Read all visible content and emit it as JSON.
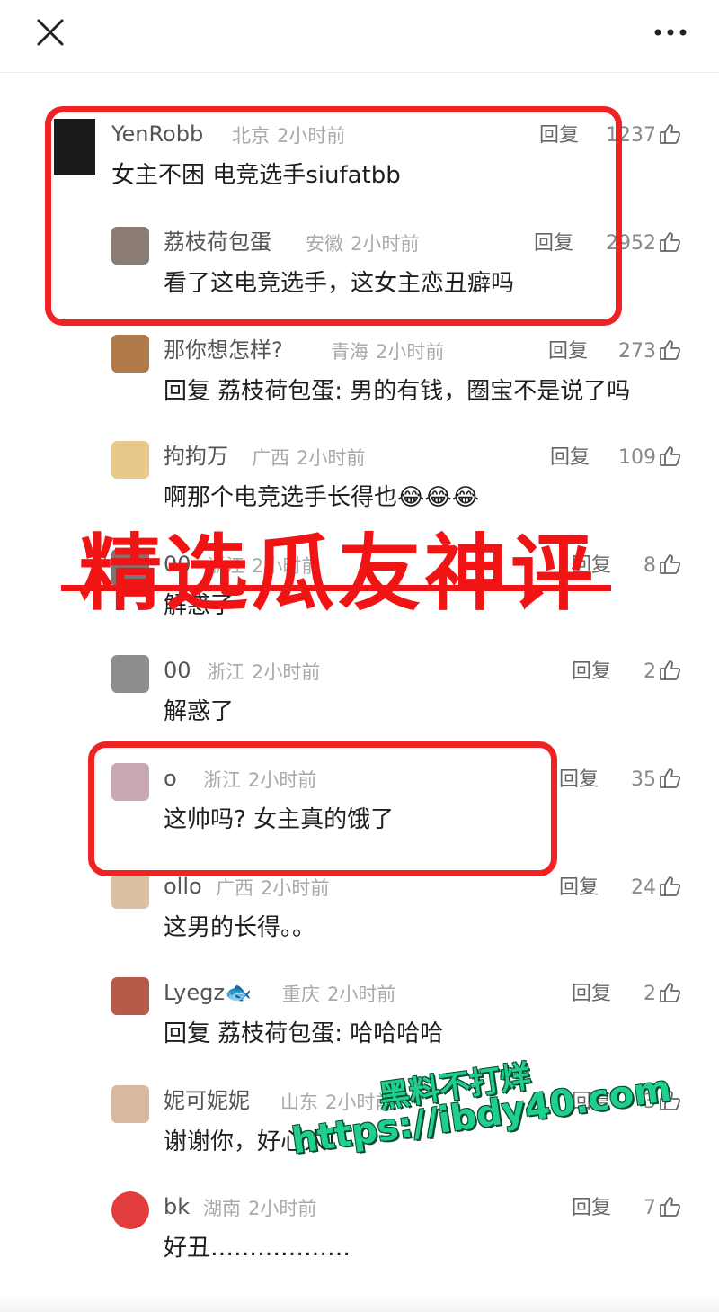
{
  "header": {
    "close_icon": "close-icon",
    "more_icon": "more-icon"
  },
  "comments": [
    {
      "name": "YenRobb",
      "location": "北京",
      "time": "2小时前",
      "reply": "回复",
      "likes": "1237",
      "text": "女主不困 电竞选手siufatbb",
      "avatar_color": "#1a1a1a"
    },
    {
      "name": "荔枝荷包蛋",
      "location": "安徽",
      "time": "2小时前",
      "reply": "回复",
      "likes": "2952",
      "text": "看了这电竞选手，这女主恋丑癖吗",
      "avatar_color": "#8a7b74"
    },
    {
      "name": "那你想怎样?",
      "location": "青海",
      "time": "2小时前",
      "reply": "回复",
      "likes": "273",
      "text": "回复 荔枝荷包蛋: 男的有钱，圈宝不是说了吗",
      "avatar_color": "#b07a4a"
    },
    {
      "name": "拘拘万",
      "location": "广西",
      "time": "2小时前",
      "reply": "回复",
      "likes": "109",
      "text": "啊那个电竞选手长得也😂😂😂",
      "avatar_color": "#e8c98a"
    },
    {
      "name": "00",
      "location": "浙江",
      "time": "2小时前",
      "reply": "回复",
      "likes": "8",
      "text": "解惑了",
      "avatar_color": "#777777"
    },
    {
      "name": "00",
      "location": "浙江",
      "time": "2小时前",
      "reply": "回复",
      "likes": "2",
      "text": "解惑了",
      "avatar_color": "#8d8d8d"
    },
    {
      "name": "o",
      "location": "浙江",
      "time": "2小时前",
      "reply": "回复",
      "likes": "35",
      "text": "这帅吗? 女主真的饿了",
      "avatar_color": "#c9a8b5"
    },
    {
      "name": "ollo",
      "location": "广西",
      "time": "2小时前",
      "reply": "回复",
      "likes": "24",
      "text": "这男的长得。。",
      "avatar_color": "#d9c0a0"
    },
    {
      "name": "Lyegz🐟",
      "location": "重庆",
      "time": "2小时前",
      "reply": "回复",
      "likes": "2",
      "text": "回复 荔枝荷包蛋: 哈哈哈哈",
      "avatar_color": "#b85a4a"
    },
    {
      "name": "妮可妮妮",
      "location": "山东",
      "time": "2小时前",
      "reply": "回复",
      "likes": "3",
      "text": "谢谢你，好心人!",
      "avatar_color": "#d8b9a0"
    },
    {
      "name": "bk",
      "location": "湖南",
      "time": "2小时前",
      "reply": "回复",
      "likes": "7",
      "text": "好丑………………",
      "avatar_color": "#e23c3c"
    }
  ],
  "overlay": {
    "banner": "精选瓜友神评",
    "watermark_line1": "黑料不打烊",
    "watermark_line2": "https://ibdy40.com",
    "highlight_color": "#ef2323",
    "watermark_color": "#1fd08c"
  }
}
